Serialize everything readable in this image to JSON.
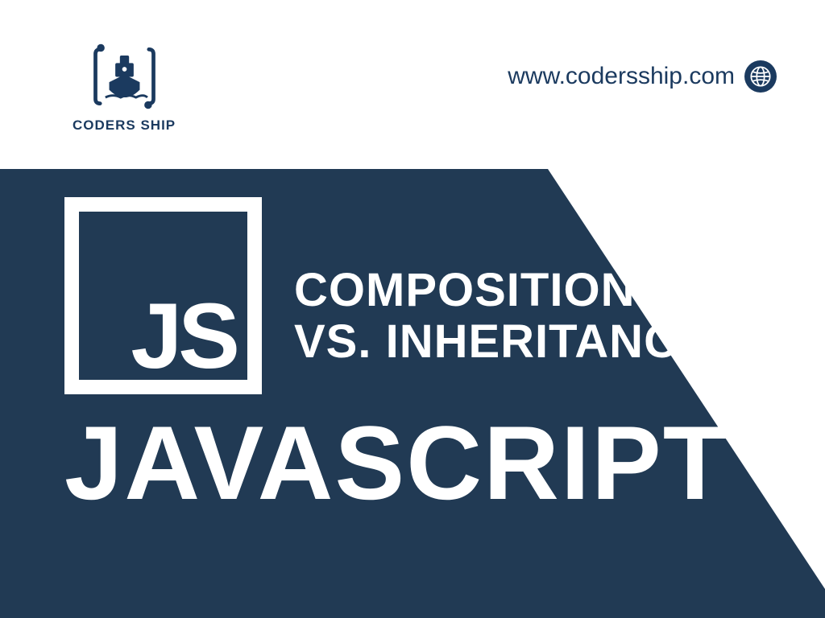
{
  "header": {
    "logo_text": "CODERS SHIP",
    "url": "www.codersship.com"
  },
  "content": {
    "js_label": "JS",
    "title_line1": "COMPOSITION",
    "title_line2": "VS. INHERITANCE",
    "main_title": "JAVASCRIPT"
  },
  "colors": {
    "primary": "#213a54",
    "logo": "#1b3a5f"
  }
}
